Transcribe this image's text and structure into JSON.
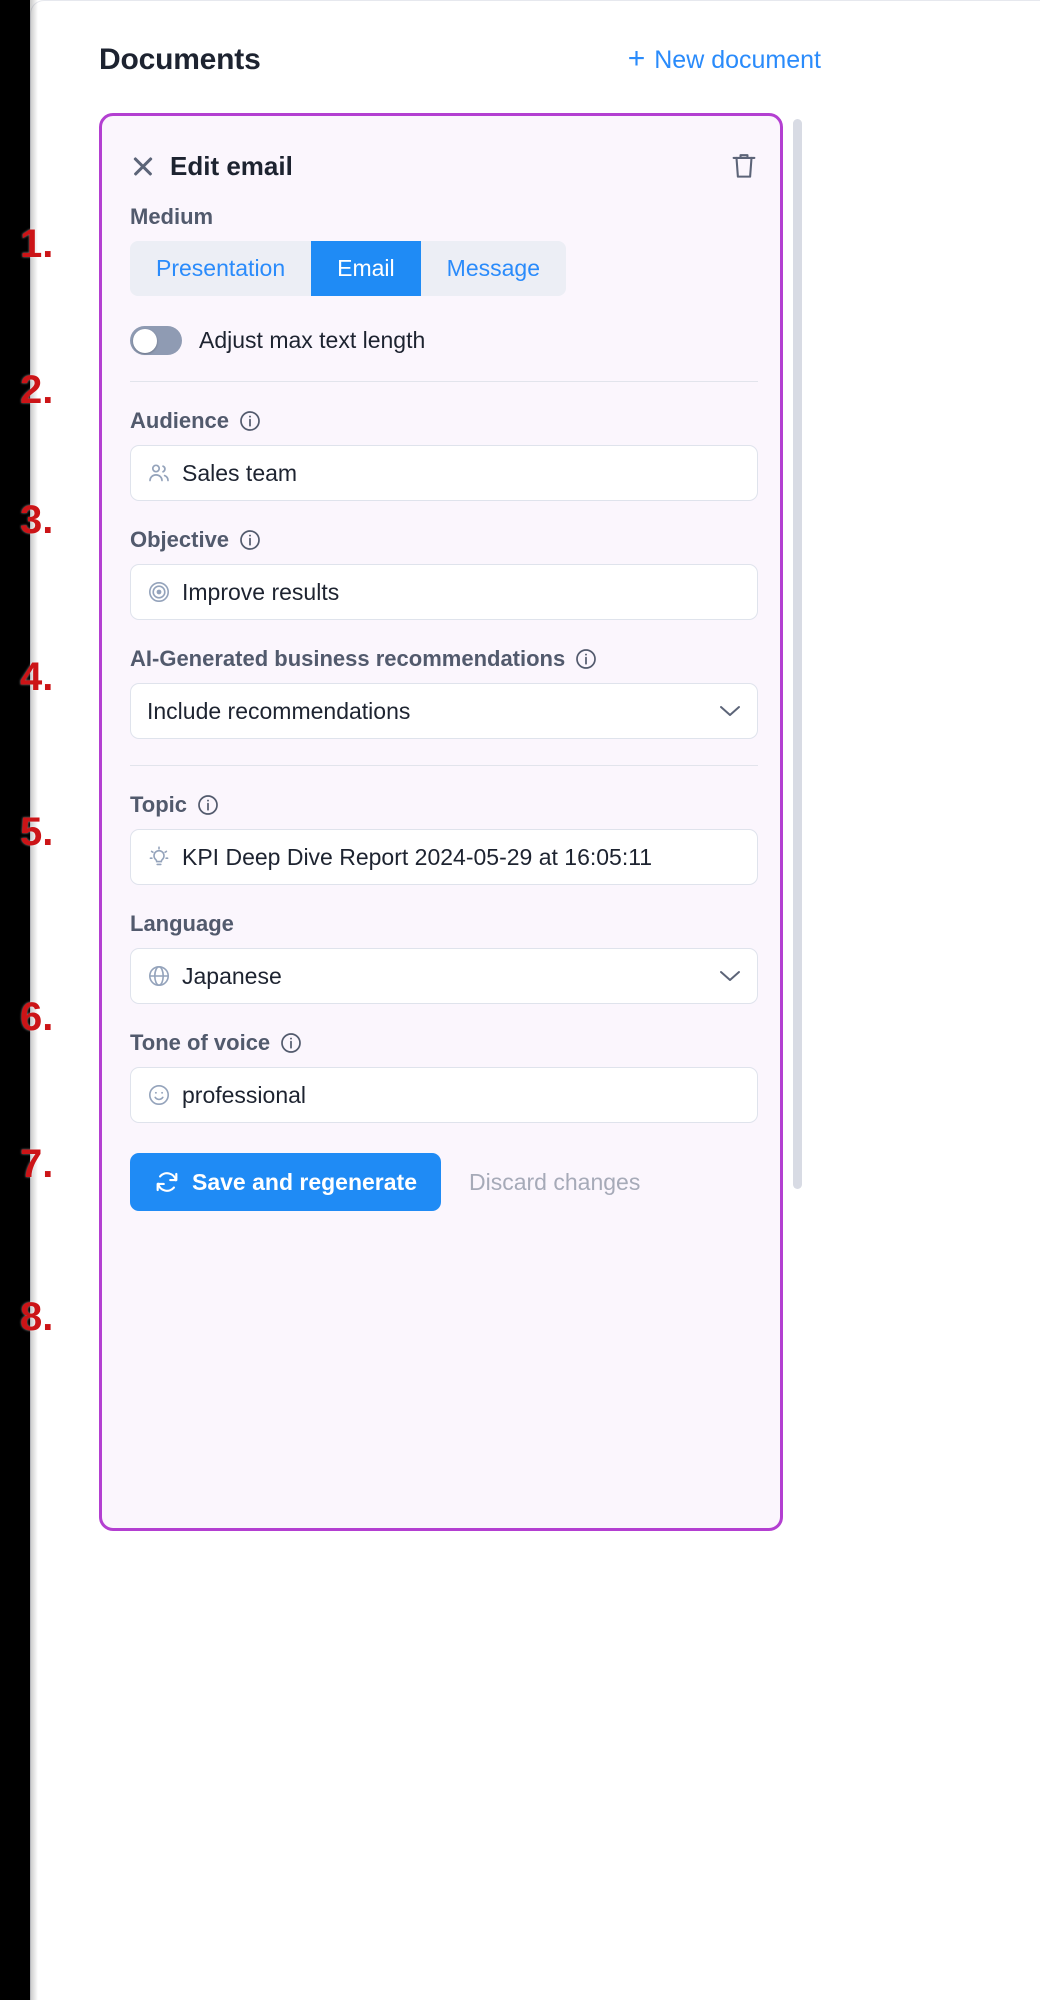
{
  "header": {
    "title": "Documents",
    "new_document_label": "New document",
    "plus_icon": "plus-icon",
    "accent_blue": "#2a8bfb"
  },
  "panel": {
    "title": "Edit email",
    "close_icon": "close-icon",
    "delete_icon": "trash-icon",
    "border_color": "#b33fd1",
    "background": "#fbf6fd"
  },
  "medium": {
    "label": "Medium",
    "options": [
      "Presentation",
      "Email",
      "Message"
    ],
    "selected": "Email",
    "selected_bg": "#1f8bf5"
  },
  "max_text_length": {
    "label": "Adjust max text length",
    "enabled": false
  },
  "audience": {
    "label": "Audience",
    "info_icon": "info-icon",
    "value": "Sales team",
    "icon": "users-icon"
  },
  "objective": {
    "label": "Objective",
    "info_icon": "info-icon",
    "value": "Improve results",
    "icon": "target-icon"
  },
  "recommendations": {
    "label": "AI-Generated business recommendations",
    "info_icon": "info-icon",
    "value": "Include recommendations",
    "chevron_icon": "chevron-down-icon"
  },
  "topic": {
    "label": "Topic",
    "info_icon": "info-icon",
    "value": "KPI Deep Dive Report 2024-05-29 at 16:05:11",
    "icon": "lightbulb-icon"
  },
  "language": {
    "label": "Language",
    "value": "Japanese",
    "icon": "globe-icon",
    "chevron_icon": "chevron-down-icon"
  },
  "tone": {
    "label": "Tone of voice",
    "info_icon": "info-icon",
    "value": "professional",
    "icon": "smiley-icon"
  },
  "actions": {
    "save_label": "Save and regenerate",
    "save_icon": "refresh-icon",
    "discard_label": "Discard changes"
  },
  "steps": {
    "s1": "1.",
    "s2": "2.",
    "s3": "3.",
    "s4": "4.",
    "s5": "5.",
    "s6": "6.",
    "s7": "7.",
    "s8": "8.",
    "color": "#cc1417"
  }
}
